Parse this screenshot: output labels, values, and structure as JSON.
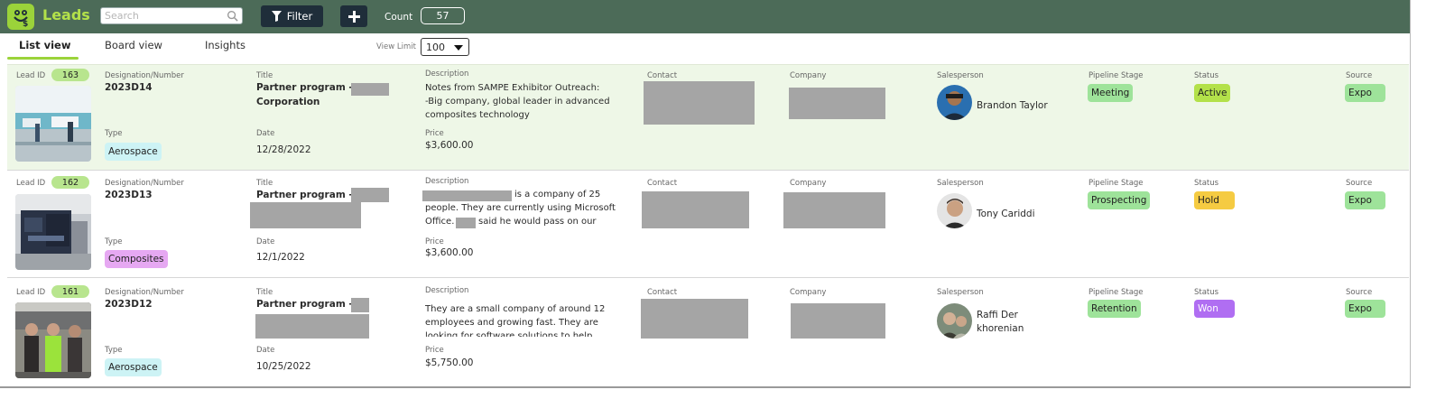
{
  "app": {
    "title": "Leads",
    "logo_icon": "frog-dollar-icon"
  },
  "toolbar": {
    "search_placeholder": "Search",
    "filter_label": "Filter",
    "add_label": "+",
    "count_label": "Count",
    "count_value": "57"
  },
  "tabs": [
    "List view",
    "Board view",
    "Insights"
  ],
  "view_limit": {
    "label": "View Limit",
    "value": "100"
  },
  "field_labels": {
    "lead_id": "Lead ID",
    "designation": "Designation/Number",
    "title": "Title",
    "description": "Description",
    "contact": "Contact",
    "company": "Company",
    "salesperson": "Salesperson",
    "pipeline": "Pipeline Stage",
    "status": "Status",
    "source": "Source",
    "type": "Type",
    "date": "Date",
    "price": "Price"
  },
  "colors": {
    "topbar": "#4c6b58",
    "accent": "#9bd33a",
    "pipeline": "#9ee39a",
    "status_active": "#b3e14a",
    "status_hold": "#f5cb42",
    "status_won": "#b06ef2",
    "type_aerospace": "#cdf3f5",
    "type_composites": "#e6a8f2",
    "source": "#9ee39a"
  },
  "leads": [
    {
      "id": "163",
      "designation": "2023D14",
      "title_line1": "Partner program -",
      "title_line2": "Corporation",
      "description": "Notes from SAMPE Exhibitor Outreach:\n-Big company, global leader in advanced composites technology",
      "type": "Aerospace",
      "date": "12/28/2022",
      "price": "$3,600.00",
      "salesperson": "Brandon Taylor",
      "pipeline": "Meeting",
      "status": "Active",
      "source": "Expo"
    },
    {
      "id": "162",
      "designation": "2023D13",
      "title_line1": "Partner program -",
      "title_line2": "",
      "description_l1": "is a company of 25",
      "description_l2": "people. They are currently using Microsoft",
      "description_l3a": "Office.",
      "description_l3b": "said he would pass on our",
      "type": "Composites",
      "date": "12/1/2022",
      "price": "$3,600.00",
      "salesperson": "Tony Cariddi",
      "pipeline": "Prospecting",
      "status": "Hold",
      "source": "Expo"
    },
    {
      "id": "161",
      "designation": "2023D12",
      "title_line1": "Partner program -",
      "title_line2": "",
      "description": "They are a small company of around 12 employees and growing fast. They are looking for software solutions to help",
      "type": "Aerospace",
      "date": "10/25/2022",
      "price": "$5,750.00",
      "salesperson_l1": "Raffi Der",
      "salesperson_l2": "khorenian",
      "pipeline": "Retention",
      "status": "Won",
      "source": "Expo"
    }
  ]
}
